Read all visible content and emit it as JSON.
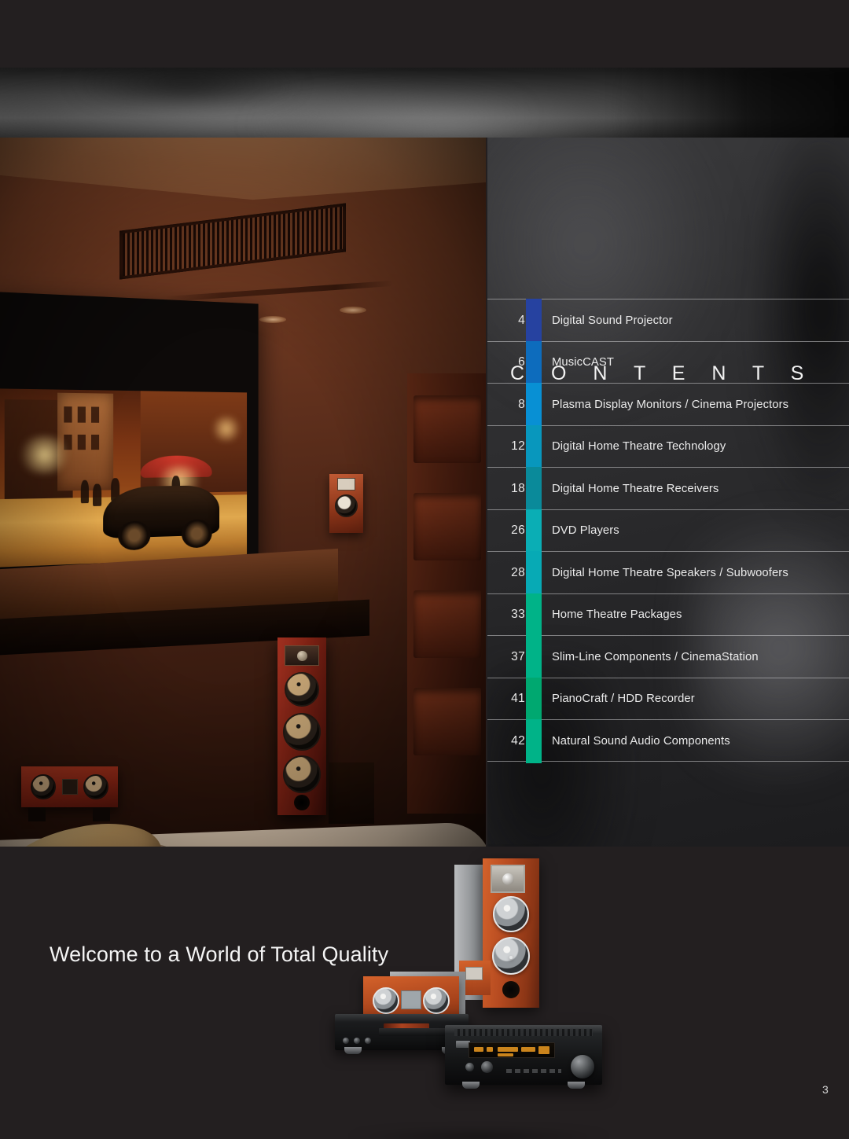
{
  "page": {
    "number": "3",
    "background_color": "#231f20"
  },
  "contents": {
    "heading": "C O N T E N T S",
    "entries": [
      {
        "page": "4",
        "title": "Digital Sound Projector",
        "color": "#2642a0"
      },
      {
        "page": "6",
        "title": "MusicCAST",
        "color": "#0d6cbd"
      },
      {
        "page": "8",
        "title": "Plasma Display Monitors / Cinema Projectors",
        "color": "#0890d4"
      },
      {
        "page": "12",
        "title": "Digital Home Theatre Technology",
        "color": "#0897bd"
      },
      {
        "page": "18",
        "title": "Digital Home Theatre Receivers",
        "color": "#0a8a9a"
      },
      {
        "page": "26",
        "title": "DVD Players",
        "color": "#0aaeb5"
      },
      {
        "page": "28",
        "title": "Digital Home Theatre Speakers / Subwoofers",
        "color": "#07aab5"
      },
      {
        "page": "33",
        "title": "Home Theatre Packages",
        "color": "#00b388"
      },
      {
        "page": "37",
        "title": "Slim-Line Components / CinemaStation",
        "color": "#00b388"
      },
      {
        "page": "41",
        "title": "PianoCraft / HDD Recorder",
        "color": "#00a870"
      },
      {
        "page": "42",
        "title": "Natural Sound Audio Components",
        "color": "#00b388"
      }
    ]
  },
  "footer": {
    "tagline": "Welcome to a World of Total Quality"
  },
  "photo": {
    "caption": "home-theatre-room-with-projection-screen-and-speakers"
  },
  "products": {
    "caption": "audio-product-group-tower-speaker-center-speaker-dvd-player-av-receiver"
  }
}
